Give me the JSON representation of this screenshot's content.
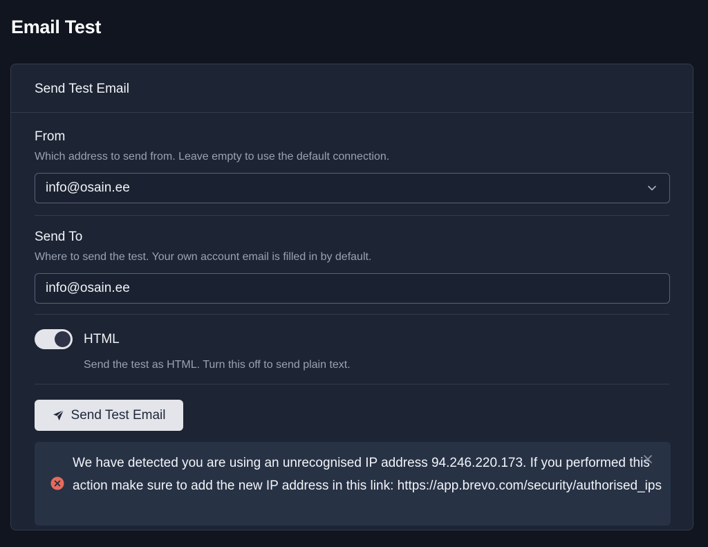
{
  "page": {
    "title": "Email Test"
  },
  "card": {
    "title": "Send Test Email",
    "from": {
      "label": "From",
      "help": "Which address to send from. Leave empty to use the default connection.",
      "selected": "info@osain.ee"
    },
    "send_to": {
      "label": "Send To",
      "help": "Where to send the test. Your own account email is filled in by default.",
      "value": "info@osain.ee"
    },
    "html_toggle": {
      "label": "HTML",
      "help": "Send the test as HTML. Turn this off to send plain text.",
      "enabled": true
    },
    "send_button": {
      "label": "Send Test Email",
      "icon": "paper-plane-icon"
    },
    "alert": {
      "type": "error",
      "icon": "error-circle-icon",
      "message": "We have detected you are using an unrecognised IP address 94.246.220.173. If you performed this action make sure to add the new IP address in this link: https://app.brevo.com/security/authorised_ips"
    }
  },
  "colors": {
    "background": "#101520",
    "card": "#1d2433",
    "border": "#343c4e",
    "alert_bg": "#273245",
    "error_icon": "#e56b5d",
    "button_bg": "#e3e5ea"
  }
}
